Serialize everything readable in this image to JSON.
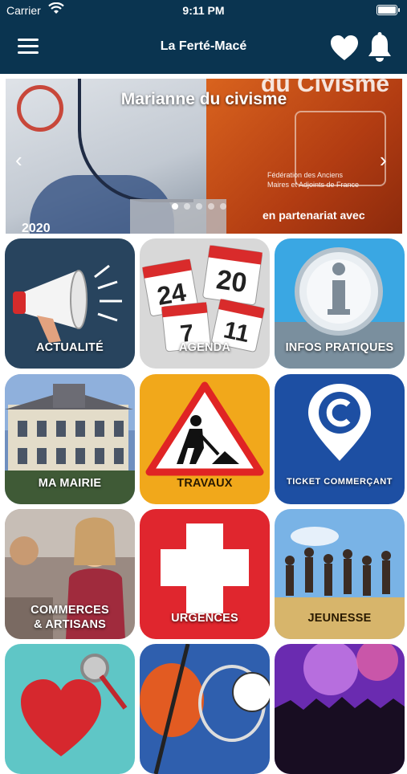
{
  "status_bar": {
    "carrier": "Carrier",
    "time": "9:11 PM"
  },
  "header": {
    "title": "La Ferté-Macé"
  },
  "banner": {
    "caption": "Marianne du civisme",
    "top_text": "du Civisme",
    "org_line1": "Fédération des Anciens",
    "org_line2": "Maires et Adjoints de France",
    "partner_text": "en partenariat avec",
    "year": "2020",
    "prev_arrow": "‹",
    "next_arrow": "›"
  },
  "tiles": [
    {
      "label_line1": "ACTUALITÉ",
      "label_line2": "",
      "color": "#2e4d6a"
    },
    {
      "label_line1": "AGENDA",
      "label_line2": "",
      "color": "#e8e8e8"
    },
    {
      "label_line1": "INFOS PRATIQUES",
      "label_line2": "",
      "color": "#3aa7e3"
    },
    {
      "label_line1": "MA MAIRIE",
      "label_line2": "",
      "color": "#6f8fbf"
    },
    {
      "label_line1": "TRAVAUX",
      "label_line2": "",
      "color": "#f1a81b"
    },
    {
      "label_line1": "TICKET COMMERÇANT",
      "label_line2": "",
      "color": "#1d4fa3"
    },
    {
      "label_line1": "COMMERCES",
      "label_line2": "& ARTISANS",
      "color": "#9a8a82"
    },
    {
      "label_line1": "URGENCES",
      "label_line2": "",
      "color": "#e0262e"
    },
    {
      "label_line1": "JEUNESSE",
      "label_line2": "",
      "color": "#79b3e6"
    }
  ],
  "icons": [
    "menu-icon",
    "heart-icon",
    "bell-icon",
    "wifi-icon",
    "battery-icon"
  ]
}
